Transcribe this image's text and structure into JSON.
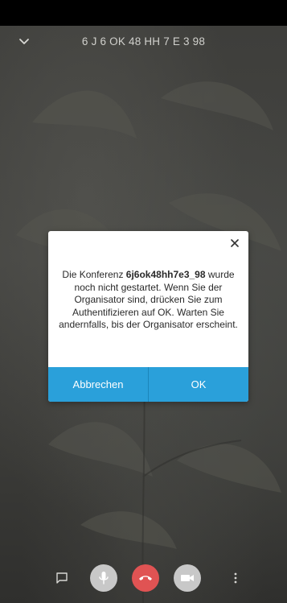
{
  "header": {
    "room_code": "6 J 6 OK 48 HH 7 E 3 98",
    "collapse_icon": "chevron-down-icon"
  },
  "dialog": {
    "message_prefix": "Die Konferenz ",
    "room_name": "6j6ok48hh7e3_98",
    "message_suffix": " wurde noch nicht gestartet. Wenn Sie der Organisator sind, drücken Sie zum Authentifizieren auf OK. Warten Sie andernfalls, bis der Organisator erscheint.",
    "cancel_label": "Abbrechen",
    "ok_label": "OK",
    "close_icon": "close-icon",
    "button_color": "#2aa0da"
  },
  "toolbar": {
    "items": [
      {
        "icon": "chat-icon"
      },
      {
        "icon": "microphone-icon",
        "color": "#c8c8c8"
      },
      {
        "icon": "hangup-icon",
        "color": "#e05353"
      },
      {
        "icon": "camera-icon",
        "color": "#c8c8c8"
      },
      {
        "icon": "more-icon"
      }
    ]
  }
}
